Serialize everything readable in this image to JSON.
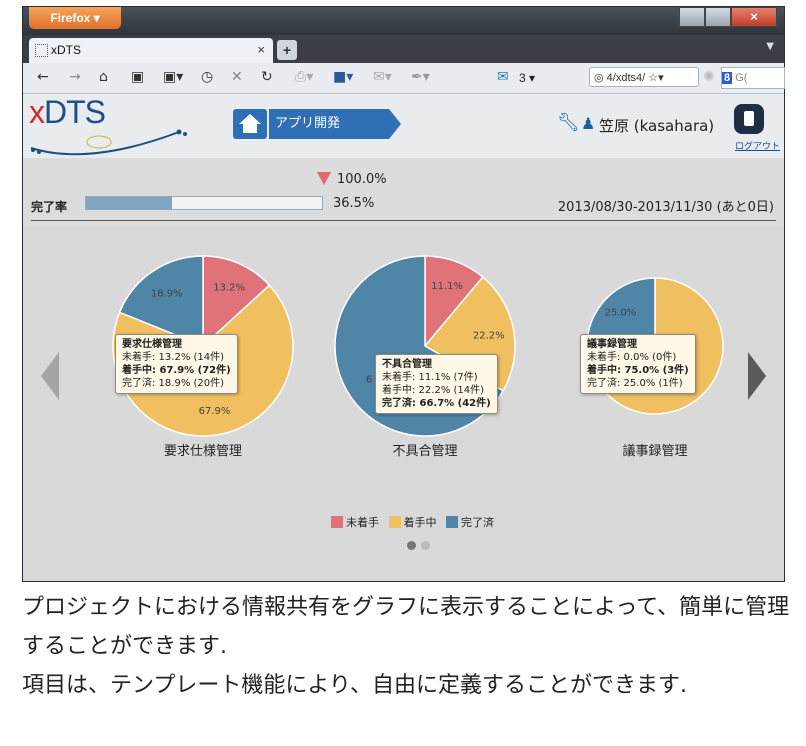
{
  "browser": {
    "menu_label": "Firefox ▾",
    "tab_title": "xDTS",
    "tab_close": "×",
    "new_tab": "+",
    "mail_count": "3 ▾",
    "url": "4/xdts4/",
    "search_placeholder": "G("
  },
  "app": {
    "logo": {
      "x": "x",
      "rest": "DTS"
    },
    "breadcrumb": "アプリ開発",
    "user_name": "笠原 (kasahara)",
    "logout": "ログアウト"
  },
  "progress": {
    "label": "完了率",
    "target": "100.0%",
    "current": "36.5%",
    "fraction": 0.365,
    "period": "2013/08/30-2013/11/30 (あと0日)"
  },
  "colors": {
    "not_started": "#e0727a",
    "in_progress": "#f0c060",
    "done": "#4f86a8"
  },
  "legend": {
    "not_started": "未着手",
    "in_progress": "着手中",
    "done": "完了済"
  },
  "chart_data": [
    {
      "type": "pie",
      "title": "要求仕様管理",
      "slices": [
        {
          "label": "未着手",
          "value": 13.2,
          "count": 14
        },
        {
          "label": "着手中",
          "value": 67.9,
          "count": 72
        },
        {
          "label": "完了済",
          "value": 18.9,
          "count": 20
        }
      ],
      "slice_labels": [
        "13.2%",
        "67.9%",
        "18.9%"
      ],
      "tooltip": {
        "title": "要求仕様管理",
        "lines": [
          "未着手: 13.2% (14件)",
          "着手中: 67.9% (72件)",
          "完了済: 18.9% (20件)"
        ],
        "bold_index": 1
      }
    },
    {
      "type": "pie",
      "title": "不具合管理",
      "slices": [
        {
          "label": "未着手",
          "value": 11.1,
          "count": 7
        },
        {
          "label": "着手中",
          "value": 22.2,
          "count": 14
        },
        {
          "label": "完了済",
          "value": 66.7,
          "count": 42
        }
      ],
      "slice_labels": [
        "11.1%",
        "22.2%",
        "6"
      ],
      "tooltip": {
        "title": "不具合管理",
        "lines": [
          "未着手: 11.1% (7件)",
          "着手中: 22.2% (14件)",
          "完了済: 66.7% (42件)"
        ],
        "bold_index": 2
      }
    },
    {
      "type": "pie",
      "title": "議事録管理",
      "slices": [
        {
          "label": "未着手",
          "value": 0.0,
          "count": 0
        },
        {
          "label": "着手中",
          "value": 75.0,
          "count": 3
        },
        {
          "label": "完了済",
          "value": 25.0,
          "count": 1
        }
      ],
      "slice_labels": [
        "",
        "",
        "25.0%"
      ],
      "tooltip": {
        "title": "議事録管理",
        "lines": [
          "未着手: 0.0% (0件)",
          "着手中: 75.0% (3件)",
          "完了済: 25.0% (1件)"
        ],
        "bold_index": 1
      }
    }
  ],
  "caption": {
    "line1": "プロジェクトにおける情報共有をグラフに表示することによって、簡単に管理することができます.",
    "line2": "項目は、テンプレート機能により、自由に定義することができます."
  }
}
